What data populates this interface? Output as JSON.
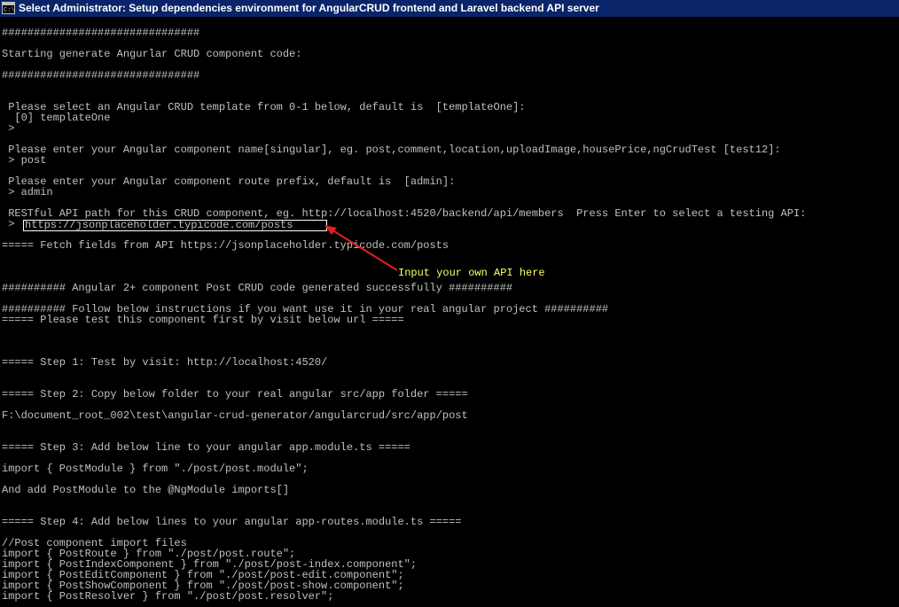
{
  "window": {
    "title": "Select Administrator:  Setup dependencies environment for AngularCRUD frontend and Laravel backend API server",
    "icon": "cmd-icon"
  },
  "console": {
    "lines": [
      "###############################",
      "Starting generate Angurlar CRUD component code:",
      "###############################",
      " Please select an Angular CRUD template from 0-1 below, default is  [templateOne]:",
      "  [0] templateOne",
      " >",
      " Please enter your Angular component name[singular], eg. post,comment,location,uploadImage,housePrice,ngCrudTest [test12]:",
      " > post",
      " Please enter your Angular component route prefix, default is  [admin]:",
      " > admin",
      " RESTful API path for this CRUD component, eg. http://localhost:4520/backend/api/members  Press Enter to select a testing API:",
      " >",
      "===== Fetch fields from API https://jsonplaceholder.typicode.com/posts",
      "########## Angular 2+ component Post CRUD code generated successfully ##########",
      "########## Follow below instructions if you want use it in your real angular project ##########",
      "===== Please test this component first by visit below url =====",
      "===== Step 1: Test by visit: http://localhost:4520/",
      "===== Step 2: Copy below folder to your real angular src/app folder =====",
      "F:\\document_root_002\\test\\angular-crud-generator/angularcrud/src/app/post",
      "===== Step 3: Add below line to your angular app.module.ts =====",
      "import { PostModule } from \"./post/post.module\";",
      "And add PostModule to the @NgModule imports[]",
      "===== Step 4: Add below lines to your angular app-routes.module.ts =====",
      "//Post component import files",
      "import { PostRoute } from \"./post/post.route\";",
      "import { PostIndexComponent } from \"./post/post-index.component\";",
      "import { PostEditComponent } from \"./post/post-edit.component\";",
      "import { PostShowComponent } from \"./post/post-show.component\";",
      "import { PostResolver } from \"./post/post.resolver\";"
    ],
    "api_input_value": "https://jsonplaceholder.typicode.com/posts"
  },
  "annotation": {
    "text": "Input your own API here"
  },
  "colors": {
    "background": "#000000",
    "text": "#c0c0c0",
    "titlebar": "#0a246a",
    "arrow": "#e02020",
    "annotation": "#ffff66"
  }
}
